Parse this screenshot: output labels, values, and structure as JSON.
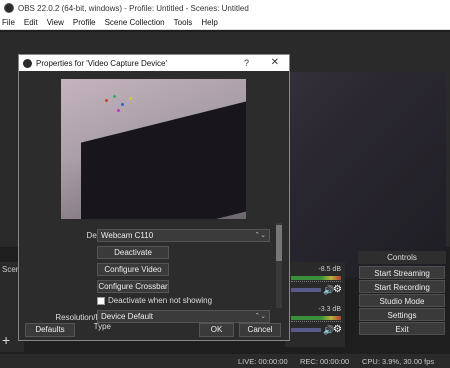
{
  "window": {
    "title": "OBS 22.0.2 (64-bit, windows) - Profile: Untitled - Scenes: Untitled"
  },
  "menu": {
    "items": [
      "File",
      "Edit",
      "View",
      "Profile",
      "Scene Collection",
      "Tools",
      "Help"
    ]
  },
  "dialog": {
    "title": "Properties for 'Video Capture Device'",
    "help": "?",
    "close": "✕",
    "device_label": "Device",
    "device_value": "Webcam C110",
    "deactivate": "Deactivate",
    "configure_video": "Configure Video",
    "configure_crossbar": "Configure Crossbar",
    "deactivate_when_not_showing": "Deactivate when not showing",
    "resolution_label": "Resolution/FPS Type",
    "resolution_value": "Device Default",
    "defaults": "Defaults",
    "ok": "OK",
    "cancel": "Cancel"
  },
  "scenes": {
    "header": "Scen",
    "add": "+"
  },
  "mixer": {
    "channels": [
      {
        "db": "-8.5 dB"
      },
      {
        "db": "-3.3 dB"
      }
    ],
    "volume_icon": "speaker-icon",
    "gear_icon": "gear-icon"
  },
  "controls": {
    "header": "Controls",
    "buttons": [
      "Start Streaming",
      "Start Recording",
      "Studio Mode",
      "Settings",
      "Exit"
    ]
  },
  "status": {
    "live": "LIVE: 00:00:00",
    "rec": "REC: 00:00:00",
    "cpu": "CPU: 3.9%, 30.00 fps"
  }
}
